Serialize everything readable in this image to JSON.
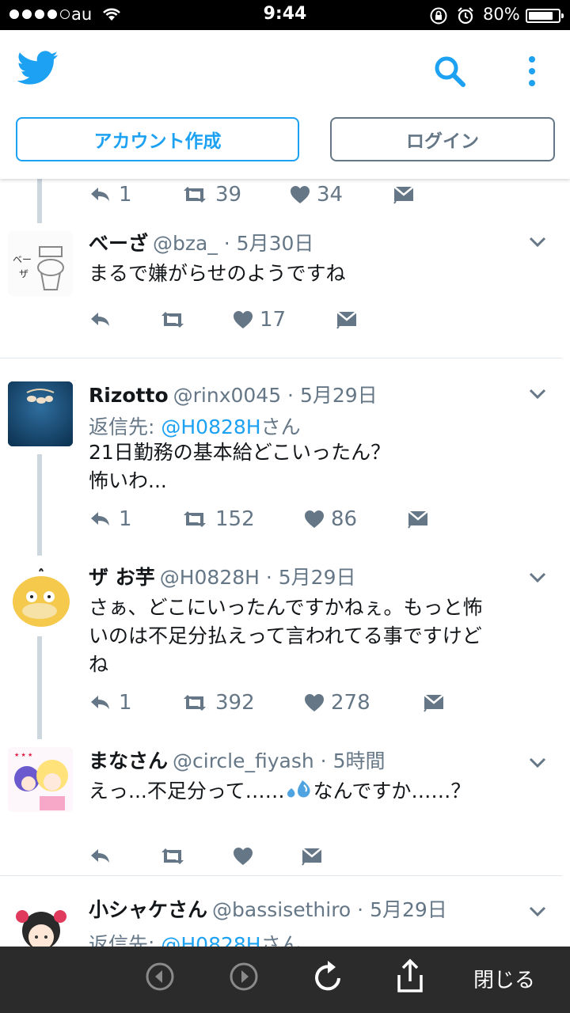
{
  "status_bar": {
    "carrier": "au",
    "time": "9:44",
    "battery": "80%",
    "battery_level": 0.8
  },
  "header": {
    "signup_label": "アカウント作成",
    "login_label": "ログイン",
    "brand_color": "#1da1f2"
  },
  "top_actions": {
    "reply": "1",
    "retweet": "39",
    "like": "34"
  },
  "tweets": [
    {
      "name": "べーざ",
      "meta": "@bza_ · 5月30日",
      "text": "まるで嫌がらせのようですね",
      "reply": "",
      "retweet": "",
      "like": "17"
    },
    {
      "name": "Rizotto",
      "meta": "@rinx0045 · 5月29日",
      "reply_prefix": "返信先: ",
      "reply_handle": "@H0828H",
      "reply_suffix": "さん",
      "text_line1": "21日勤務の基本給どこいったん？",
      "text_line2": "怖いわ...",
      "reply": "1",
      "retweet": "152",
      "like": "86"
    },
    {
      "name": "ザ お芋",
      "meta": "@H0828H · 5月29日",
      "text_line1": "さぁ、どこにいったんですかねぇ。もっと怖",
      "text_line2": "いのは不足分払えって言われてる事ですけど",
      "text_line3": "ね",
      "reply": "1",
      "retweet": "392",
      "like": "278"
    },
    {
      "name": "まなさん",
      "meta": "@circle_fiyash · 5時間",
      "text_before": "えっ...不足分って……",
      "text_after": "なんですか……？",
      "reply": "",
      "retweet": "",
      "like": ""
    },
    {
      "name": "小シャケさん",
      "meta": "@bassisethiro · 5月29日",
      "reply_prefix": "返信先: ",
      "reply_handle": "@H0828H",
      "reply_suffix": "さん"
    }
  ],
  "bottom_bar": {
    "close_label": "閉じる"
  }
}
